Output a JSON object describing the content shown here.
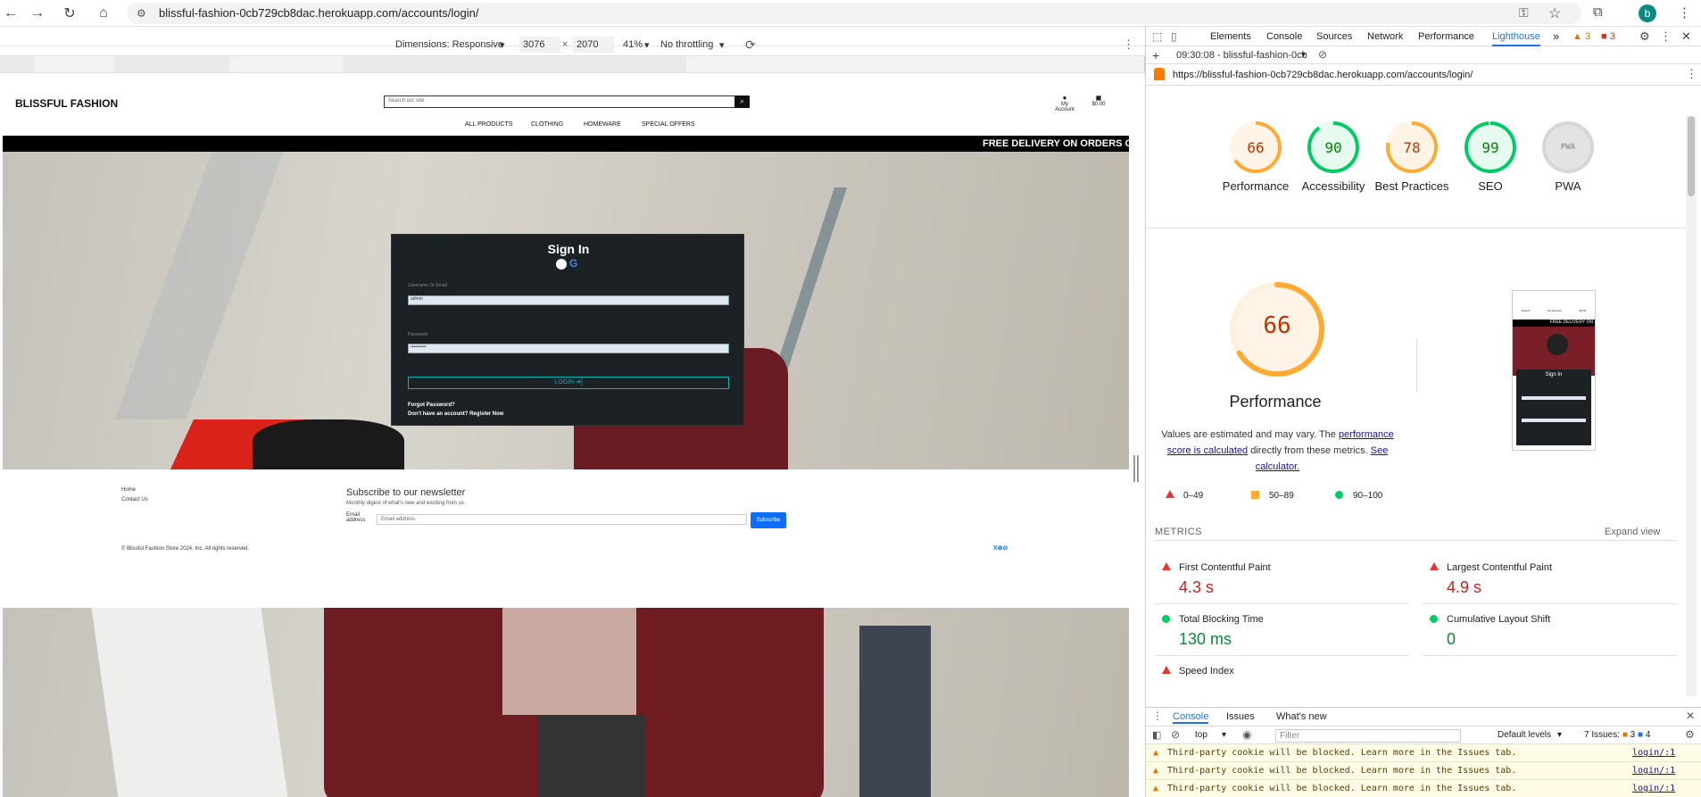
{
  "browser": {
    "url": "blissful-fashion-0cb729cb8dac.herokuapp.com/accounts/login/",
    "profile_initial": "b"
  },
  "device_toolbar": {
    "dimensions_label": "Dimensions: Responsive",
    "width": "3076",
    "times": "×",
    "height": "2070",
    "zoom": "41%",
    "throttle": "No throttling"
  },
  "site": {
    "logo": "BLISSFUL FASHION",
    "search_placeholder": "Search our site",
    "my_account": "My Account",
    "cart_total": "$0.00",
    "nav": [
      "ALL PRODUCTS",
      "CLOTHING",
      "HOMEWARE",
      "SPECIAL OFFERS"
    ],
    "banner": "FREE DELIVERY ON ORDERS O",
    "signin": {
      "title": "Sign In",
      "username_label": "Username Or Email",
      "username_value": "admin",
      "password_label": "Password",
      "password_value": "••••••••••",
      "login_button": "LOGIN ➜]",
      "forgot": "Forgot Password?",
      "register": "Don't have an account? Register Now"
    },
    "footer": {
      "links": [
        "Home",
        "Contact Us"
      ],
      "newsletter_title": "Subscribe to our newsletter",
      "newsletter_sub": "Monthly digest of what's new and exciting from us.",
      "email_label": "Email address",
      "email_placeholder": "Email address",
      "subscribe": "Subscribe",
      "copyright": "© Blissful Fashion Store 2024, Inc. All rights reserved.",
      "social": "X⊕⊘"
    }
  },
  "devtools": {
    "tabs": [
      "Elements",
      "Console",
      "Sources",
      "Network",
      "Performance",
      "Lighthouse"
    ],
    "more_tabs": "»",
    "warn_count": "3",
    "err_count": "3",
    "report_time": "09:30:08 - blissful-fashion-0cb",
    "report_url": "https://blissful-fashion-0cb729cb8dac.herokuapp.com/accounts/login/",
    "scores": [
      {
        "label": "Performance",
        "value": 66,
        "color": "#fa3"
      },
      {
        "label": "Accessibility",
        "value": 90,
        "color": "#0c6"
      },
      {
        "label": "Best Practices",
        "value": 78,
        "color": "#fa3"
      },
      {
        "label": "SEO",
        "value": 99,
        "color": "#0c6"
      },
      {
        "label": "PWA",
        "value": "PWA",
        "color": "#ccc"
      }
    ],
    "big_score": 66,
    "big_label": "Performance",
    "desc_1": "Values are estimated and may vary. The ",
    "desc_link1": "performance score is calculated",
    "desc_2": " directly from these metrics. ",
    "desc_link2": "See calculator.",
    "legend": [
      "0–49",
      "50–89",
      "90–100"
    ],
    "metrics_title": "METRICS",
    "expand_view": "Expand view",
    "metrics": [
      {
        "name": "First Contentful Paint",
        "value": "4.3 s",
        "status": "bad"
      },
      {
        "name": "Largest Contentful Paint",
        "value": "4.9 s",
        "status": "bad"
      },
      {
        "name": "Total Blocking Time",
        "value": "130 ms",
        "status": "good"
      },
      {
        "name": "Cumulative Layout Shift",
        "value": "0",
        "status": "good"
      },
      {
        "name": "Speed Index",
        "value": "",
        "status": "bad"
      }
    ],
    "thumb": {
      "banner": "FREE DELIVERY ON",
      "signin": "Sign In",
      "icons": [
        "Search",
        "My Account",
        "$0.00"
      ]
    }
  },
  "console": {
    "tabs": [
      "Console",
      "Issues",
      "What's new"
    ],
    "context": "top",
    "filter_placeholder": "Filter",
    "levels": "Default levels",
    "issues": "7 Issues:",
    "issues_warn": "3",
    "issues_info": "4",
    "rows": [
      {
        "text": "Third-party cookie will be blocked. Learn more in the Issues tab.",
        "link": "login/:1"
      },
      {
        "text": "Third-party cookie will be blocked. Learn more in the Issues tab.",
        "link": "login/:1"
      },
      {
        "text": "Third-party cookie will be blocked. Learn more in the Issues tab.",
        "link": "login/:1"
      }
    ]
  }
}
